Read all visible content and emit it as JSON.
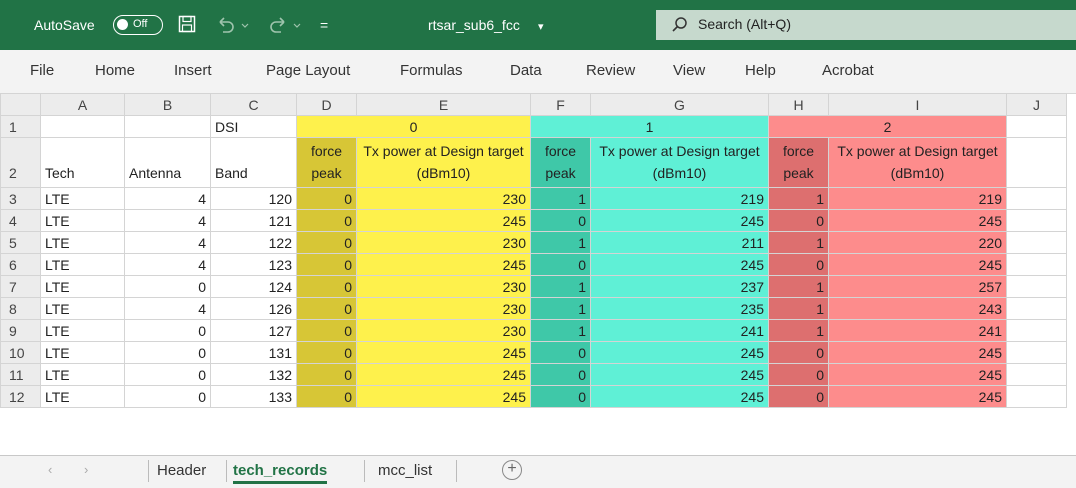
{
  "titlebar": {
    "autosave_label": "AutoSave",
    "autosave_state": "Off",
    "filename": "rtsar_sub6_fcc",
    "filename_caret": "▾",
    "quick_access_more": "=",
    "search_placeholder": "Search (Alt+Q)"
  },
  "ribbon": [
    "File",
    "Home",
    "Insert",
    "Page Layout",
    "Formulas",
    "Data",
    "Review",
    "View",
    "Help",
    "Acrobat"
  ],
  "columns": [
    "A",
    "B",
    "C",
    "D",
    "E",
    "F",
    "G",
    "H",
    "I",
    "J"
  ],
  "row1": {
    "c": "DSI",
    "d": "0",
    "f": "1",
    "h": "2"
  },
  "row2": {
    "a": "Tech",
    "b": "Antenna",
    "c": "Band",
    "force_peak": "force peak",
    "tx_power": "Tx power at Design target (dBm10)"
  },
  "rows": [
    {
      "n": "3",
      "tech": "LTE",
      "ant": "4",
      "band": "120",
      "fp0": "0",
      "tx0": "230",
      "fp1": "1",
      "tx1": "219",
      "fp2": "1",
      "tx2": "219"
    },
    {
      "n": "4",
      "tech": "LTE",
      "ant": "4",
      "band": "121",
      "fp0": "0",
      "tx0": "245",
      "fp1": "0",
      "tx1": "245",
      "fp2": "0",
      "tx2": "245"
    },
    {
      "n": "5",
      "tech": "LTE",
      "ant": "4",
      "band": "122",
      "fp0": "0",
      "tx0": "230",
      "fp1": "1",
      "tx1": "211",
      "fp2": "1",
      "tx2": "220"
    },
    {
      "n": "6",
      "tech": "LTE",
      "ant": "4",
      "band": "123",
      "fp0": "0",
      "tx0": "245",
      "fp1": "0",
      "tx1": "245",
      "fp2": "0",
      "tx2": "245"
    },
    {
      "n": "7",
      "tech": "LTE",
      "ant": "0",
      "band": "124",
      "fp0": "0",
      "tx0": "230",
      "fp1": "1",
      "tx1": "237",
      "fp2": "1",
      "tx2": "257"
    },
    {
      "n": "8",
      "tech": "LTE",
      "ant": "4",
      "band": "126",
      "fp0": "0",
      "tx0": "230",
      "fp1": "1",
      "tx1": "235",
      "fp2": "1",
      "tx2": "243"
    },
    {
      "n": "9",
      "tech": "LTE",
      "ant": "0",
      "band": "127",
      "fp0": "0",
      "tx0": "230",
      "fp1": "1",
      "tx1": "241",
      "fp2": "1",
      "tx2": "241"
    },
    {
      "n": "10",
      "tech": "LTE",
      "ant": "0",
      "band": "131",
      "fp0": "0",
      "tx0": "245",
      "fp1": "0",
      "tx1": "245",
      "fp2": "0",
      "tx2": "245"
    },
    {
      "n": "11",
      "tech": "LTE",
      "ant": "0",
      "band": "132",
      "fp0": "0",
      "tx0": "245",
      "fp1": "0",
      "tx1": "245",
      "fp2": "0",
      "tx2": "245"
    },
    {
      "n": "12",
      "tech": "LTE",
      "ant": "0",
      "band": "133",
      "fp0": "0",
      "tx0": "245",
      "fp1": "0",
      "tx1": "245",
      "fp2": "0",
      "tx2": "245"
    }
  ],
  "sheet_tabs": [
    "Header",
    "tech_records",
    "mcc_list"
  ],
  "active_tab": "tech_records",
  "colors": {
    "titlebar": "#217346",
    "yellow": "#fef14c",
    "green": "#5ff0d6",
    "red": "#fd8c8c"
  }
}
